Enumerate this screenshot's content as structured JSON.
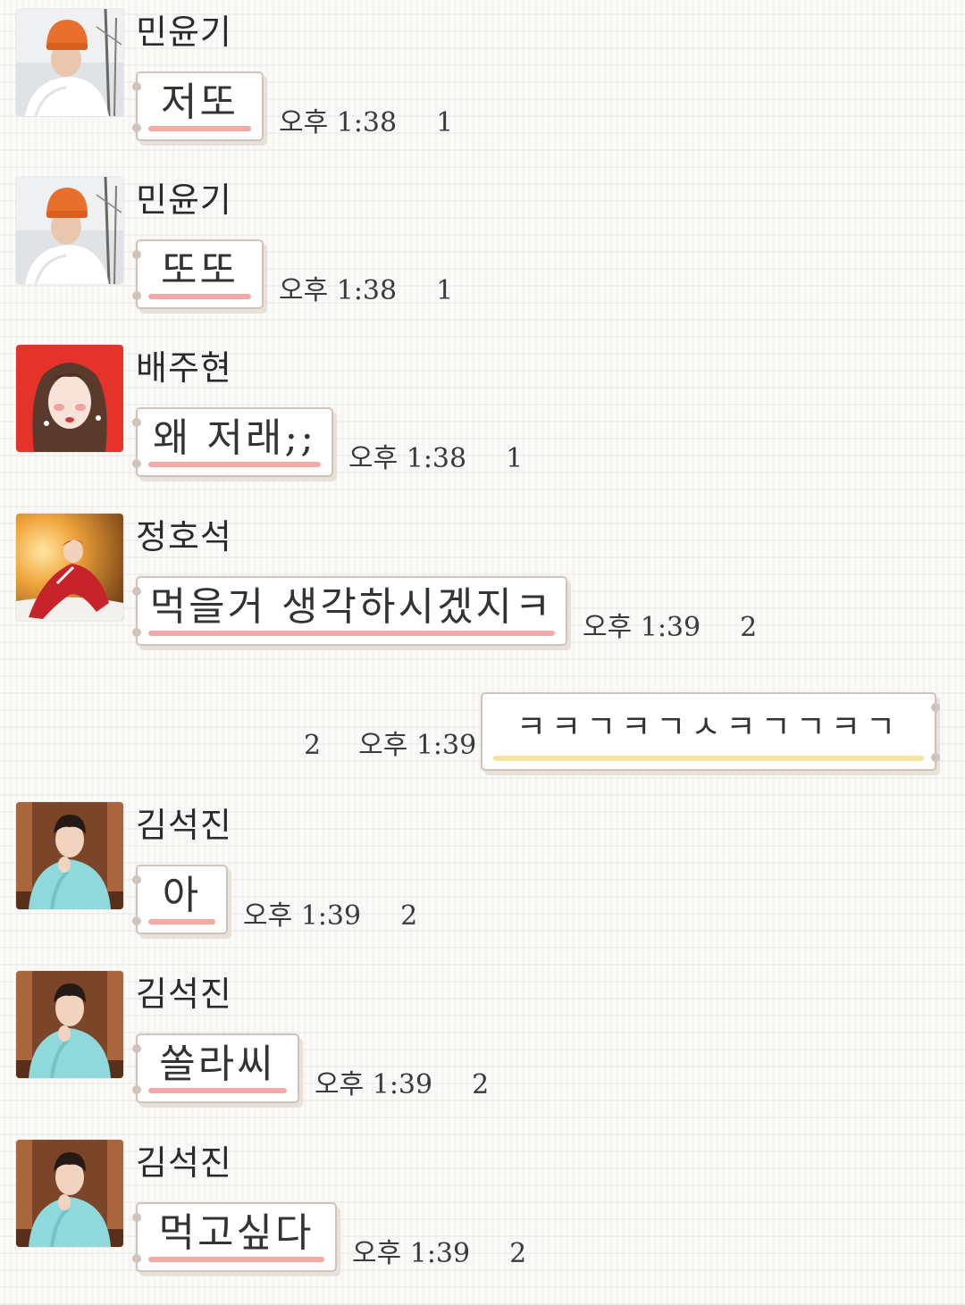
{
  "theme": {
    "incoming_underline": "#f1aaa5",
    "outgoing_underline": "#f5e59b",
    "bubble_border": "#cfc4bb",
    "text_color": "#333333"
  },
  "messages": [
    {
      "sender": "민윤기",
      "avatar": "avatar-orange-beanie",
      "text": "저또",
      "time": "오후 1:38",
      "unread": "1"
    },
    {
      "sender": "민윤기",
      "avatar": "avatar-orange-beanie",
      "text": "또또",
      "time": "오후 1:38",
      "unread": "1"
    },
    {
      "sender": "배주현",
      "avatar": "avatar-red-background",
      "text": "왜 저래;;",
      "time": "오후 1:38",
      "unread": "1"
    },
    {
      "sender": "정호석",
      "avatar": "avatar-red-jacket-night",
      "text": "먹을거 생각하시겠지ㅋ",
      "time": "오후 1:39",
      "unread": "2"
    },
    {
      "sender": "",
      "outgoing": true,
      "text": "ㅋㅋㄱㅋㄱㅅㅋㄱㄱㅋㄱ",
      "time": "오후 1:39",
      "unread": "2"
    },
    {
      "sender": "김석진",
      "avatar": "avatar-blue-sweater",
      "text": "아",
      "time": "오후 1:39",
      "unread": "2"
    },
    {
      "sender": "김석진",
      "avatar": "avatar-blue-sweater",
      "text": "쏠라씨",
      "time": "오후 1:39",
      "unread": "2"
    },
    {
      "sender": "김석진",
      "avatar": "avatar-blue-sweater",
      "text": "먹고싶다",
      "time": "오후 1:39",
      "unread": "2"
    }
  ]
}
